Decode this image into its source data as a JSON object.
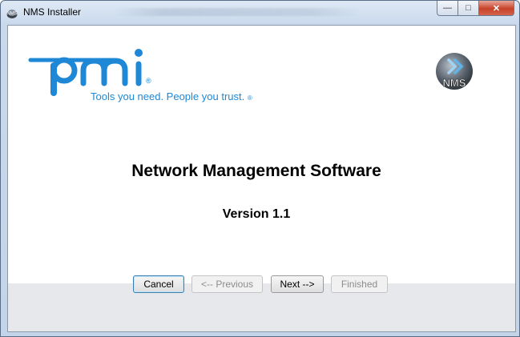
{
  "window": {
    "title": "NMS Installer",
    "blurred_title": "wizard - Installation"
  },
  "brand": {
    "logo_text": "pmi",
    "tagline": "Tools you need. People you trust.",
    "tagline_mark": "®",
    "nms_logo_text": "NMS",
    "brand_color": "#1e88d6"
  },
  "main": {
    "heading": "Network Management Software",
    "version": "Version 1.1"
  },
  "buttons": {
    "cancel": "Cancel",
    "previous": "<-- Previous",
    "next": "Next -->",
    "finished": "Finished"
  }
}
